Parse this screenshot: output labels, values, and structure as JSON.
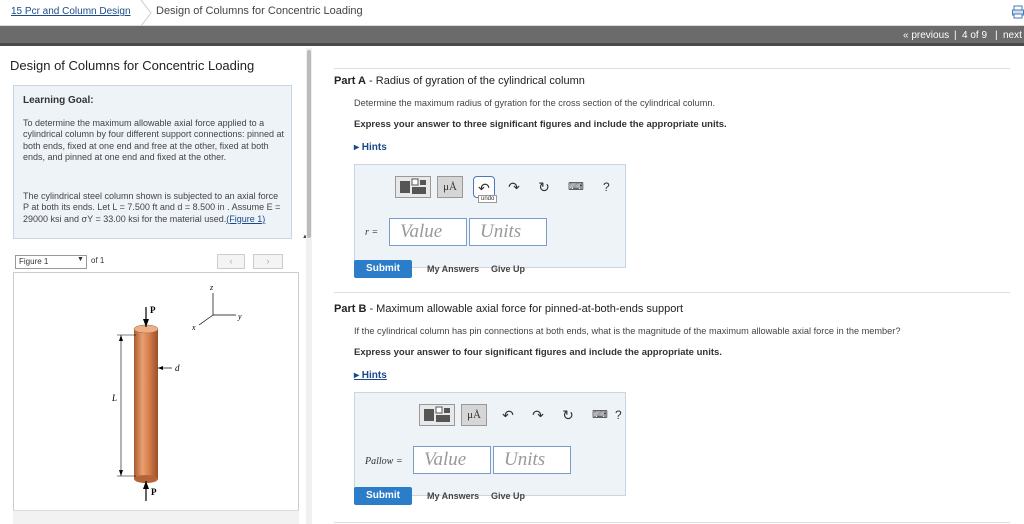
{
  "topbar": {
    "breadcrumb_link": "15 Pcr and Column Design",
    "page_title": "Design of Columns for Concentric Loading",
    "print_icon": "printer-icon"
  },
  "navbar": {
    "previous": "« previous",
    "sep1": "|",
    "position": "4 of 9",
    "sep2": "|",
    "next": "next"
  },
  "left": {
    "title": "Design of Columns for Concentric Loading",
    "goal_label": "Learning Goal:",
    "goal_text": "To determine the maximum allowable axial force applied to a cylindrical column by four different support connections: pinned at both ends, fixed at one end and free at the other, fixed at both ends, and pinned at one end and fixed at the other.",
    "desc_text": "The cylindrical steel column shown is subjected to an axial force P at both its ends. Let L = 7.500 ft and d = 8.500 in . Assume E = 29000 ksi and σY = 33.00 ksi for the material used.",
    "figure_link": "(Figure 1)",
    "figure_select": "Figure 1",
    "figure_of": "of 1",
    "prev_icon": "chevron-left-icon",
    "next_icon": "chevron-right-icon",
    "fig_labels": {
      "P_top": "P",
      "P_bottom": "P",
      "d": "d",
      "L": "L",
      "x": "x",
      "y": "y",
      "z": "z"
    }
  },
  "partA": {
    "label": "Part A",
    "title": " - Radius of gyration of the cylindrical column",
    "question": "Determine the maximum radius of gyration for the cross section of the cylindrical column.",
    "instruction": "Express your answer to three significant figures and include the appropriate units.",
    "hints": "▸ Hints",
    "var": "r =",
    "value_ph": "Value",
    "units_ph": "Units",
    "submit": "Submit",
    "my_answers": "My Answers",
    "give_up": "Give Up",
    "undo_tip": "undo"
  },
  "partB": {
    "label": "Part B",
    "title": " - Maximum allowable axial force for pinned-at-both-ends support",
    "question": "If the cylindrical column has pin connections at both ends, what is the magnitude of the maximum allowable axial force in the member?",
    "instruction": "Express your answer to four significant figures and include the appropriate units.",
    "hints": "▸ Hints",
    "var": "Pallow =",
    "value_ph": "Value",
    "units_ph": "Units",
    "submit": "Submit",
    "my_answers": "My Answers",
    "give_up": "Give Up"
  },
  "toolbar": {
    "mu": "μÅ",
    "help": "?"
  }
}
